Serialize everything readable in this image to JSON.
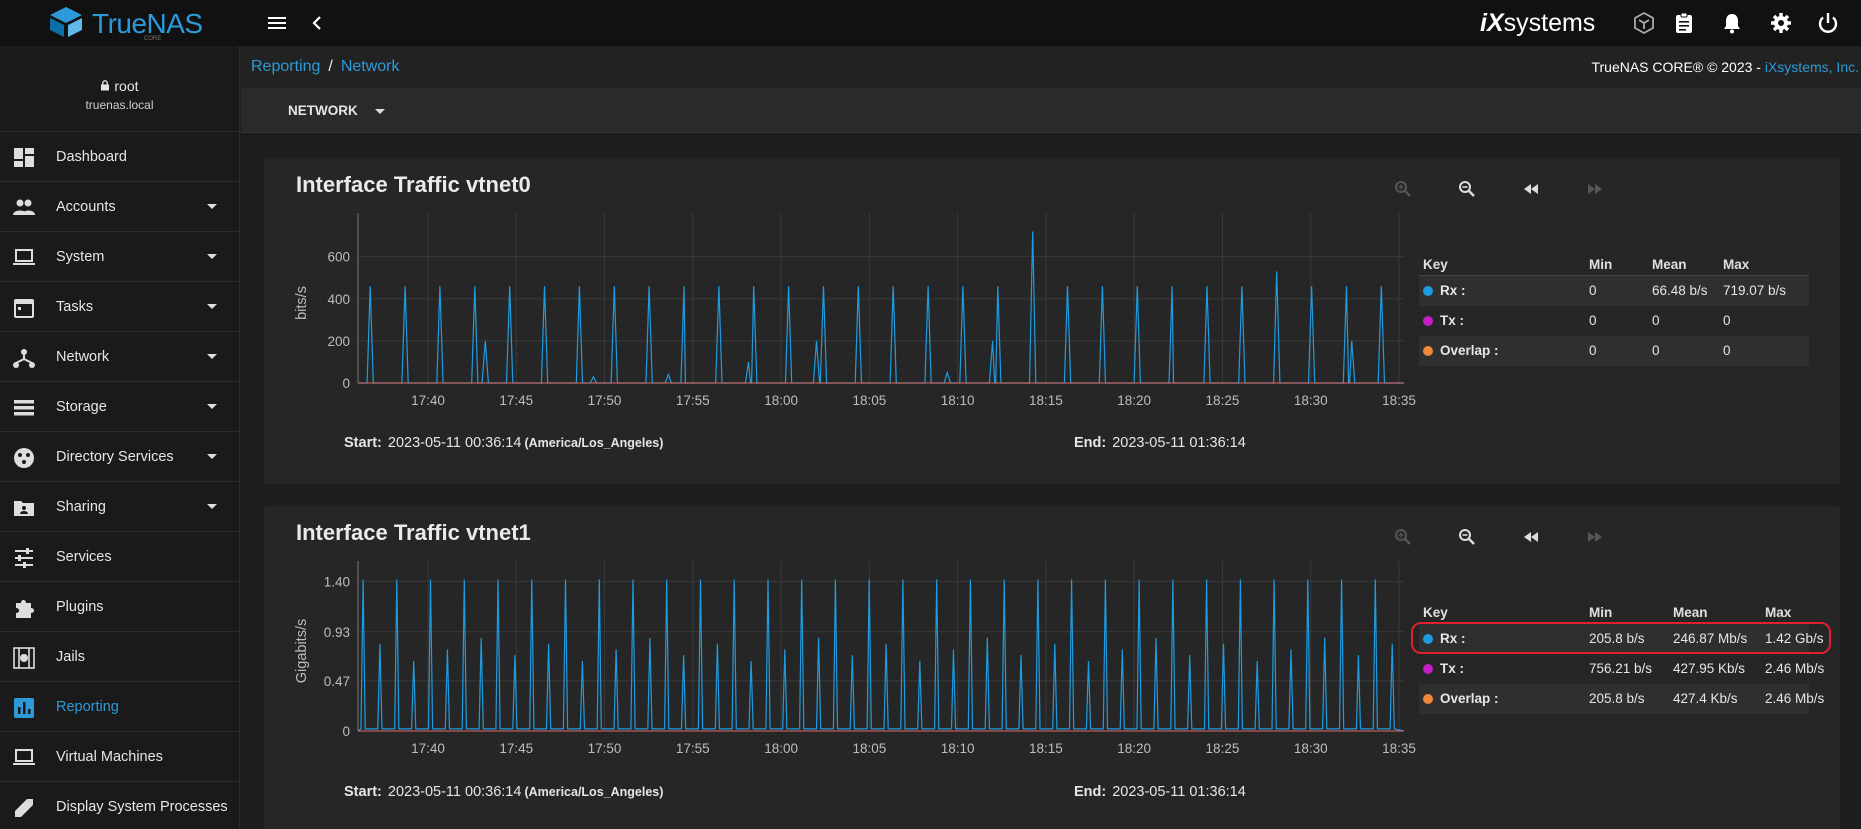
{
  "app": {
    "logo_text": "TrueNAS",
    "logo_sub": "CORE",
    "vendor_logo_ix": "iX",
    "vendor_logo_text": "systems"
  },
  "topbar": {
    "icons": [
      "menu-icon",
      "collapse-left-icon",
      "truecommand-icon",
      "task-manager-icon",
      "bell-icon",
      "gear-icon",
      "power-icon"
    ]
  },
  "user": {
    "name": "root",
    "host": "truenas.local"
  },
  "sidebar": {
    "items": [
      {
        "label": "Dashboard",
        "icon": "dashboard-icon",
        "has_caret": false
      },
      {
        "label": "Accounts",
        "icon": "accounts-icon",
        "has_caret": true
      },
      {
        "label": "System",
        "icon": "laptop-icon",
        "has_caret": true
      },
      {
        "label": "Tasks",
        "icon": "calendar-icon",
        "has_caret": true
      },
      {
        "label": "Network",
        "icon": "network-icon",
        "has_caret": true
      },
      {
        "label": "Storage",
        "icon": "storage-icon",
        "has_caret": true
      },
      {
        "label": "Directory Services",
        "icon": "directory-icon",
        "has_caret": true
      },
      {
        "label": "Sharing",
        "icon": "sharing-icon",
        "has_caret": true
      },
      {
        "label": "Services",
        "icon": "tune-icon",
        "has_caret": false
      },
      {
        "label": "Plugins",
        "icon": "puzzle-icon",
        "has_caret": false
      },
      {
        "label": "Jails",
        "icon": "jail-icon",
        "has_caret": false
      },
      {
        "label": "Reporting",
        "icon": "chart-icon",
        "has_caret": false,
        "active": true
      },
      {
        "label": "Virtual Machines",
        "icon": "laptop-icon",
        "has_caret": false
      },
      {
        "label": "Display System Processes",
        "icon": "processes-icon",
        "has_caret": false
      }
    ]
  },
  "breadcrumb": {
    "parent": "Reporting",
    "sep": "/",
    "current": "Network"
  },
  "copyright": {
    "text": "TrueNAS CORE® © 2023 - ",
    "link": "iXsystems, Inc."
  },
  "toolbar": {
    "selector_value": "NETWORK"
  },
  "colors": {
    "accent": "#2c9ad8",
    "rx": "#1f9be0",
    "tx": "#c41fc4",
    "overlap": "#f08a3a",
    "highlight": "#e0202a"
  },
  "cards": [
    {
      "title": "Interface Traffic vtnet0",
      "start_label": "Start:",
      "start_value": "2023-05-11 00:36:14",
      "timezone": "(America/Los_Angeles)",
      "end_label": "End:",
      "end_value": "2023-05-11 01:36:14",
      "legend": {
        "headers": [
          "Key",
          "Min",
          "Mean",
          "Max"
        ],
        "rows": [
          {
            "name": "Rx :",
            "min": "0",
            "mean": "66.48 b/s",
            "max": "719.07 b/s"
          },
          {
            "name": "Tx :",
            "min": "0",
            "mean": "0",
            "max": "0"
          },
          {
            "name": "Overlap :",
            "min": "0",
            "mean": "0",
            "max": "0"
          }
        ]
      }
    },
    {
      "title": "Interface Traffic vtnet1",
      "start_label": "Start:",
      "start_value": "2023-05-11 00:36:14",
      "timezone": "(America/Los_Angeles)",
      "end_label": "End:",
      "end_value": "2023-05-11 01:36:14",
      "legend": {
        "headers": [
          "Key",
          "Min",
          "Mean",
          "Max"
        ],
        "rows": [
          {
            "name": "Rx :",
            "min": "205.8 b/s",
            "mean": "246.87 Mb/s",
            "max": "1.42 Gb/s"
          },
          {
            "name": "Tx :",
            "min": "756.21 b/s",
            "mean": "427.95 Kb/s",
            "max": "2.46 Mb/s"
          },
          {
            "name": "Overlap :",
            "min": "205.8 b/s",
            "mean": "427.4 Kb/s",
            "max": "2.46 Mb/s"
          }
        ]
      }
    }
  ],
  "chart_data": [
    {
      "type": "line",
      "ylabel": "bits/s",
      "xlabel": "",
      "ylim": [
        0,
        760
      ],
      "y_ticks": [
        "0",
        "200",
        "400",
        "600"
      ],
      "y_tick_values": [
        0,
        200,
        400,
        600
      ],
      "x_ticks": [
        "17:40",
        "17:45",
        "17:50",
        "17:55",
        "18:00",
        "18:05",
        "18:10",
        "18:15",
        "18:20",
        "18:25",
        "18:30",
        "18:35"
      ],
      "grid": true,
      "series": [
        {
          "name": "Rx",
          "color": "#1f9be0",
          "x_minutes": [
            0.0,
            0.5,
            0.7,
            0.9,
            1.2,
            2.5,
            2.7,
            2.9,
            3.2,
            4.5,
            4.7,
            4.9,
            5.2,
            6.5,
            6.7,
            6.9,
            7.2,
            7.1,
            7.3,
            7.5,
            8.5,
            8.7,
            8.9,
            9.2,
            10.5,
            10.7,
            10.9,
            11.2,
            12.5,
            12.7,
            12.9,
            13.2,
            13.3,
            13.5,
            13.7,
            14.5,
            14.7,
            14.9,
            15.2,
            16.5,
            16.7,
            16.9,
            17.2,
            17.6,
            17.8,
            18.0,
            18.5,
            18.7,
            18.9,
            19.2,
            18.3,
            18.6,
            18.8,
            20.5,
            20.7,
            20.9,
            21.2,
            22.5,
            22.7,
            22.9,
            23.2,
            22.2,
            22.4,
            22.6,
            24.5,
            24.7,
            24.9,
            25.2,
            26.5,
            26.7,
            26.9,
            27.2,
            26.0,
            26.3,
            26.6,
            28.5,
            28.7,
            28.9,
            29.2,
            30.5,
            30.7,
            30.9,
            31.2,
            32.5,
            32.7,
            32.9,
            33.2,
            33.6,
            33.8,
            34.0,
            34.5,
            34.7,
            34.9,
            35.2,
            36.5,
            36.7,
            36.9,
            37.2,
            36.2,
            36.4,
            36.6,
            38.5,
            38.7,
            38.9,
            39.2,
            40.5,
            40.7,
            40.9,
            41.2,
            42.5,
            42.7,
            42.9,
            43.2,
            44.5,
            44.7,
            44.9,
            45.2,
            46.5,
            46.7,
            46.9,
            47.2,
            46.3,
            46.6,
            46.9,
            48.5,
            48.7,
            48.9,
            49.2,
            50.5,
            50.7,
            50.9,
            51.2,
            52.5,
            52.7,
            52.9,
            53.2,
            54.5,
            54.7,
            54.9,
            55.2,
            56.5,
            56.7,
            56.9,
            57.2,
            56.8,
            57.0,
            57.3,
            58.5,
            58.7,
            58.9,
            59.2,
            60.0
          ],
          "y": [
            0,
            0,
            460,
            0,
            0,
            0,
            460,
            0,
            0,
            0,
            460,
            0,
            0,
            0,
            460,
            0,
            0,
            0,
            200,
            0,
            0,
            460,
            0,
            0,
            0,
            460,
            0,
            0,
            0,
            460,
            0,
            0,
            0,
            30,
            0,
            0,
            460,
            0,
            0,
            0,
            460,
            0,
            0,
            0,
            40,
            0,
            0,
            460,
            0,
            0,
            0,
            200,
            0,
            0,
            460,
            0,
            0,
            0,
            460,
            0,
            0,
            0,
            100,
            0,
            0,
            460,
            0,
            0,
            0,
            460,
            0,
            0,
            0,
            200,
            0,
            0,
            460,
            0,
            0,
            0,
            460,
            0,
            0,
            0,
            460,
            0,
            0,
            0,
            50,
            0,
            0,
            460,
            0,
            0,
            0,
            460,
            0,
            0,
            0,
            200,
            0,
            0,
            720,
            0,
            0,
            0,
            460,
            0,
            0,
            0,
            460,
            0,
            0,
            0,
            460,
            0,
            0,
            0,
            460,
            0,
            0,
            0,
            200,
            0,
            0,
            460,
            0,
            0,
            0,
            460,
            0,
            0,
            0,
            530,
            0,
            0,
            0,
            460,
            0,
            0,
            0,
            460,
            0,
            0,
            0,
            200,
            0,
            0,
            460,
            0,
            0
          ]
        },
        {
          "name": "Tx",
          "color": "#c41fc4",
          "x_minutes": [
            0,
            60
          ],
          "y": [
            0,
            0
          ]
        },
        {
          "name": "Overlap",
          "color": "#f08a3a",
          "x_minutes": [
            0,
            60
          ],
          "y": [
            0,
            0
          ]
        }
      ]
    },
    {
      "type": "line",
      "ylabel": "Gigabits/s",
      "xlabel": "",
      "ylim": [
        0,
        1.5
      ],
      "y_ticks": [
        "0",
        "0.47",
        "0.93",
        "1.40"
      ],
      "y_tick_values": [
        0,
        0.47,
        0.93,
        1.4
      ],
      "x_ticks": [
        "17:40",
        "17:45",
        "17:50",
        "17:55",
        "18:00",
        "18:05",
        "18:10",
        "18:15",
        "18:20",
        "18:25",
        "18:30",
        "18:35"
      ],
      "grid": true,
      "series": [
        {
          "name": "Rx",
          "color": "#1f9be0",
          "pattern": "spikes",
          "spike_count": 62,
          "peak": 1.42,
          "secondary_peak": 0.9
        },
        {
          "name": "Tx",
          "color": "#c41fc4",
          "x_minutes": [
            0,
            60
          ],
          "y": [
            0,
            0
          ]
        },
        {
          "name": "Overlap",
          "color": "#f08a3a",
          "x_minutes": [
            0,
            60
          ],
          "y": [
            0,
            0
          ]
        }
      ]
    }
  ]
}
